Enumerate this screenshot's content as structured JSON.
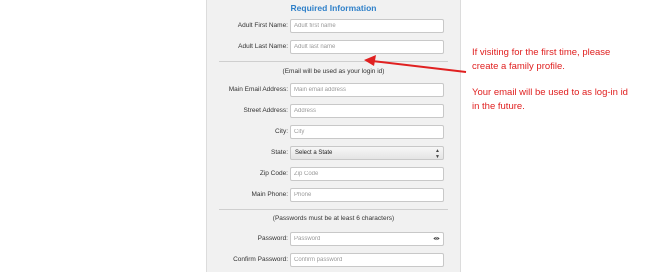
{
  "form": {
    "section_title": "Required Information",
    "fields": {
      "first_name": {
        "label": "Adult First Name:",
        "placeholder": "Adult first name"
      },
      "last_name": {
        "label": "Adult Last Name:",
        "placeholder": "Adult last name"
      },
      "email": {
        "label": "Main Email Address:",
        "placeholder": "Main email address"
      },
      "street": {
        "label": "Street Address:",
        "placeholder": "Address"
      },
      "city": {
        "label": "City:",
        "placeholder": "City"
      },
      "state": {
        "label": "State:",
        "selected": "Select a State"
      },
      "zip": {
        "label": "Zip Code:",
        "placeholder": "Zip Code"
      },
      "phone": {
        "label": "Main Phone:",
        "placeholder": "Phone"
      },
      "password": {
        "label": "Password:",
        "placeholder": "Password"
      },
      "confirm_password": {
        "label": "Confirm Password:",
        "placeholder": "Confirm password"
      }
    },
    "email_note": "(Email will be used as your login id)",
    "password_note": "(Passwords must be at least 6 characters)"
  },
  "annotation": {
    "line1": "If visiting for the first time, please",
    "line2": "create a family profile.",
    "line3": "Your email will be used to as log-in id",
    "line4": "in the future.",
    "color": "#e02020"
  },
  "icons": {
    "password_toggle": "eye-icon",
    "state_select": "updown-arrows-icon"
  }
}
